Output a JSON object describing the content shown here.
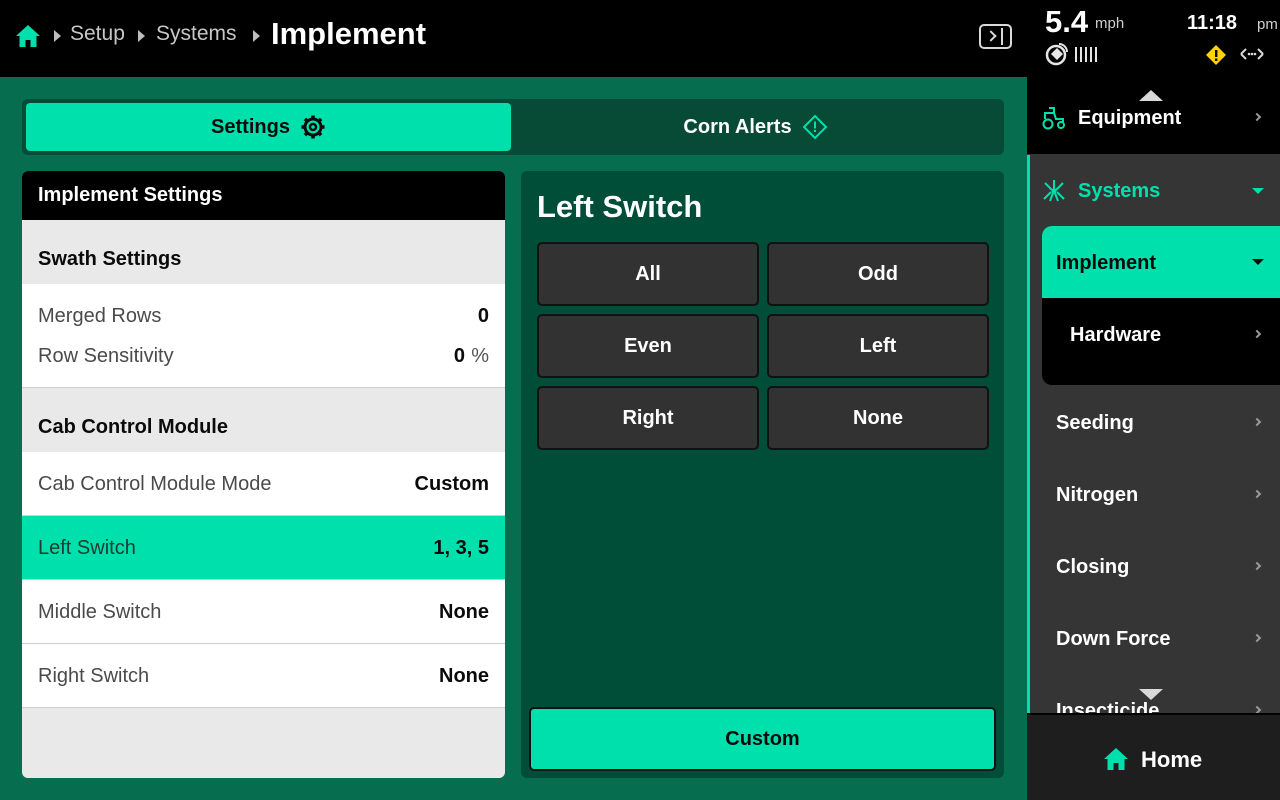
{
  "colors": {
    "accent": "#00e0ad",
    "main_bg": "#066e4e",
    "panel_dark": "#004e37",
    "sidebar_bg": "#353535",
    "warning": "#ffd200"
  },
  "breadcrumb": {
    "home_icon": "home-icon",
    "items": [
      "Setup",
      "Systems"
    ],
    "current": "Implement"
  },
  "status": {
    "speed": "5.4",
    "speed_unit": "mph",
    "time": "11:18",
    "ampm": "pm",
    "gps_icon": "gps-satellite-icon",
    "warning_icon": "warning-icon",
    "link_icon": "connection-icon"
  },
  "tabs": [
    {
      "label": "Settings",
      "icon": "gear-icon",
      "active": true
    },
    {
      "label": "Corn Alerts",
      "icon": "alert-diamond-icon",
      "active": false
    }
  ],
  "settings": {
    "title": "Implement Settings",
    "swath": {
      "header": "Swath Settings",
      "merged_rows": {
        "label": "Merged Rows",
        "value": "0"
      },
      "row_sensitivity": {
        "label": "Row Sensitivity",
        "value": "0",
        "unit": "%"
      }
    },
    "ccm": {
      "header": "Cab Control Module",
      "rows": [
        {
          "label": "Cab Control Module Mode",
          "value": "Custom"
        },
        {
          "label": "Left Switch",
          "value": "1, 3, 5"
        },
        {
          "label": "Middle Switch",
          "value": "None"
        },
        {
          "label": "Right Switch",
          "value": "None"
        }
      ]
    }
  },
  "switch_panel": {
    "title": "Left Switch",
    "options": [
      "All",
      "Odd",
      "Even",
      "Left",
      "Right",
      "None"
    ],
    "custom_label": "Custom"
  },
  "sidebar": {
    "equipment": "Equipment",
    "systems": "Systems",
    "implement": "Implement",
    "hardware": "Hardware",
    "items": [
      "Seeding",
      "Nitrogen",
      "Closing",
      "Down Force",
      "Insecticide"
    ],
    "home": "Home"
  }
}
